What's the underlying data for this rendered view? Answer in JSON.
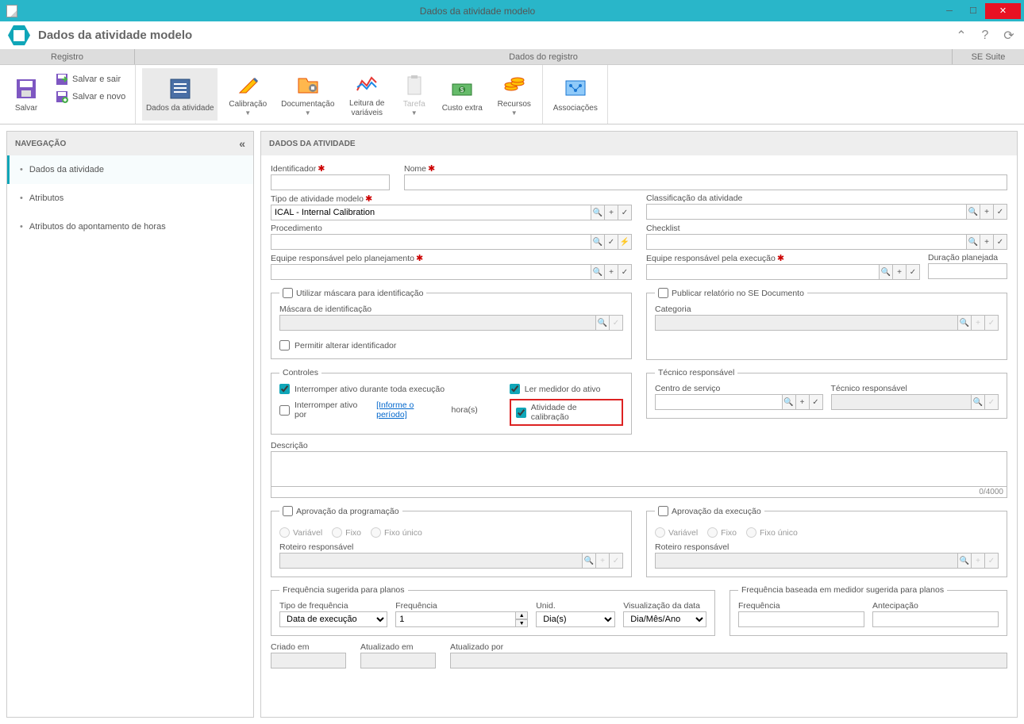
{
  "window": {
    "title": "Dados da atividade modelo"
  },
  "header": {
    "title": "Dados da atividade modelo"
  },
  "tabs": {
    "registro": "Registro",
    "dados": "Dados do registro",
    "sesuite": "SE Suite"
  },
  "ribbon": {
    "salvar": "Salvar",
    "salvar_sair": "Salvar e sair",
    "salvar_novo": "Salvar e novo",
    "dados_atividade": "Dados da atividade",
    "calibracao": "Calibração",
    "documentacao": "Documentação",
    "leitura_variaveis": "Leitura de variáveis",
    "tarefa": "Tarefa",
    "custo_extra": "Custo extra",
    "recursos": "Recursos",
    "associacoes": "Associações"
  },
  "nav": {
    "title": "NAVEGAÇÃO",
    "items": [
      "Dados da atividade",
      "Atributos",
      "Atributos do apontamento de horas"
    ]
  },
  "content": {
    "title": "DADOS DA ATIVIDADE",
    "labels": {
      "identificador": "Identificador",
      "nome": "Nome",
      "tipo_atividade": "Tipo de atividade modelo",
      "classificacao": "Classificação da atividade",
      "procedimento": "Procedimento",
      "checklist": "Checklist",
      "equipe_planejamento": "Equipe responsável pelo planejamento",
      "equipe_execucao": "Equipe responsável pela execução",
      "duracao": "Duração planejada",
      "mascara_legend": "Utilizar máscara para identificação",
      "mascara_label": "Máscara de identificação",
      "permitir_alterar": "Permitir alterar identificador",
      "publicar_legend": "Publicar relatório no SE Documento",
      "categoria": "Categoria",
      "controles": "Controles",
      "interromper_toda": "Interromper ativo durante toda execução",
      "interromper_por": "Interromper ativo por",
      "informe_periodo": "[Informe o período]",
      "horas": "hora(s)",
      "ler_medidor": "Ler medidor do ativo",
      "atividade_calibracao": "Atividade de calibração",
      "tecnico_legend": "Técnico responsável",
      "centro_servico": "Centro de serviço",
      "tecnico_responsavel": "Técnico responsável",
      "descricao": "Descrição",
      "char_count": "0/4000",
      "aprov_prog": "Aprovação da programação",
      "aprov_exec": "Aprovação da execução",
      "variavel": "Variável",
      "fixo": "Fixo",
      "fixo_unico": "Fixo único",
      "roteiro": "Roteiro responsável",
      "freq_sugerida": "Frequência sugerida para planos",
      "tipo_freq": "Tipo de frequência",
      "frequencia": "Frequência",
      "unid": "Unid.",
      "vis_data": "Visualização da data",
      "freq_medidor": "Frequência baseada em medidor sugerida para planos",
      "antecipacao": "Antecipação",
      "criado_em": "Criado em",
      "atualizado_em": "Atualizado em",
      "atualizado_por": "Atualizado por"
    },
    "values": {
      "tipo_atividade": "ICAL - Internal Calibration",
      "tipo_freq": "Data de execução",
      "frequencia": "1",
      "unid": "Dia(s)",
      "vis_data": "Dia/Mês/Ano"
    }
  }
}
